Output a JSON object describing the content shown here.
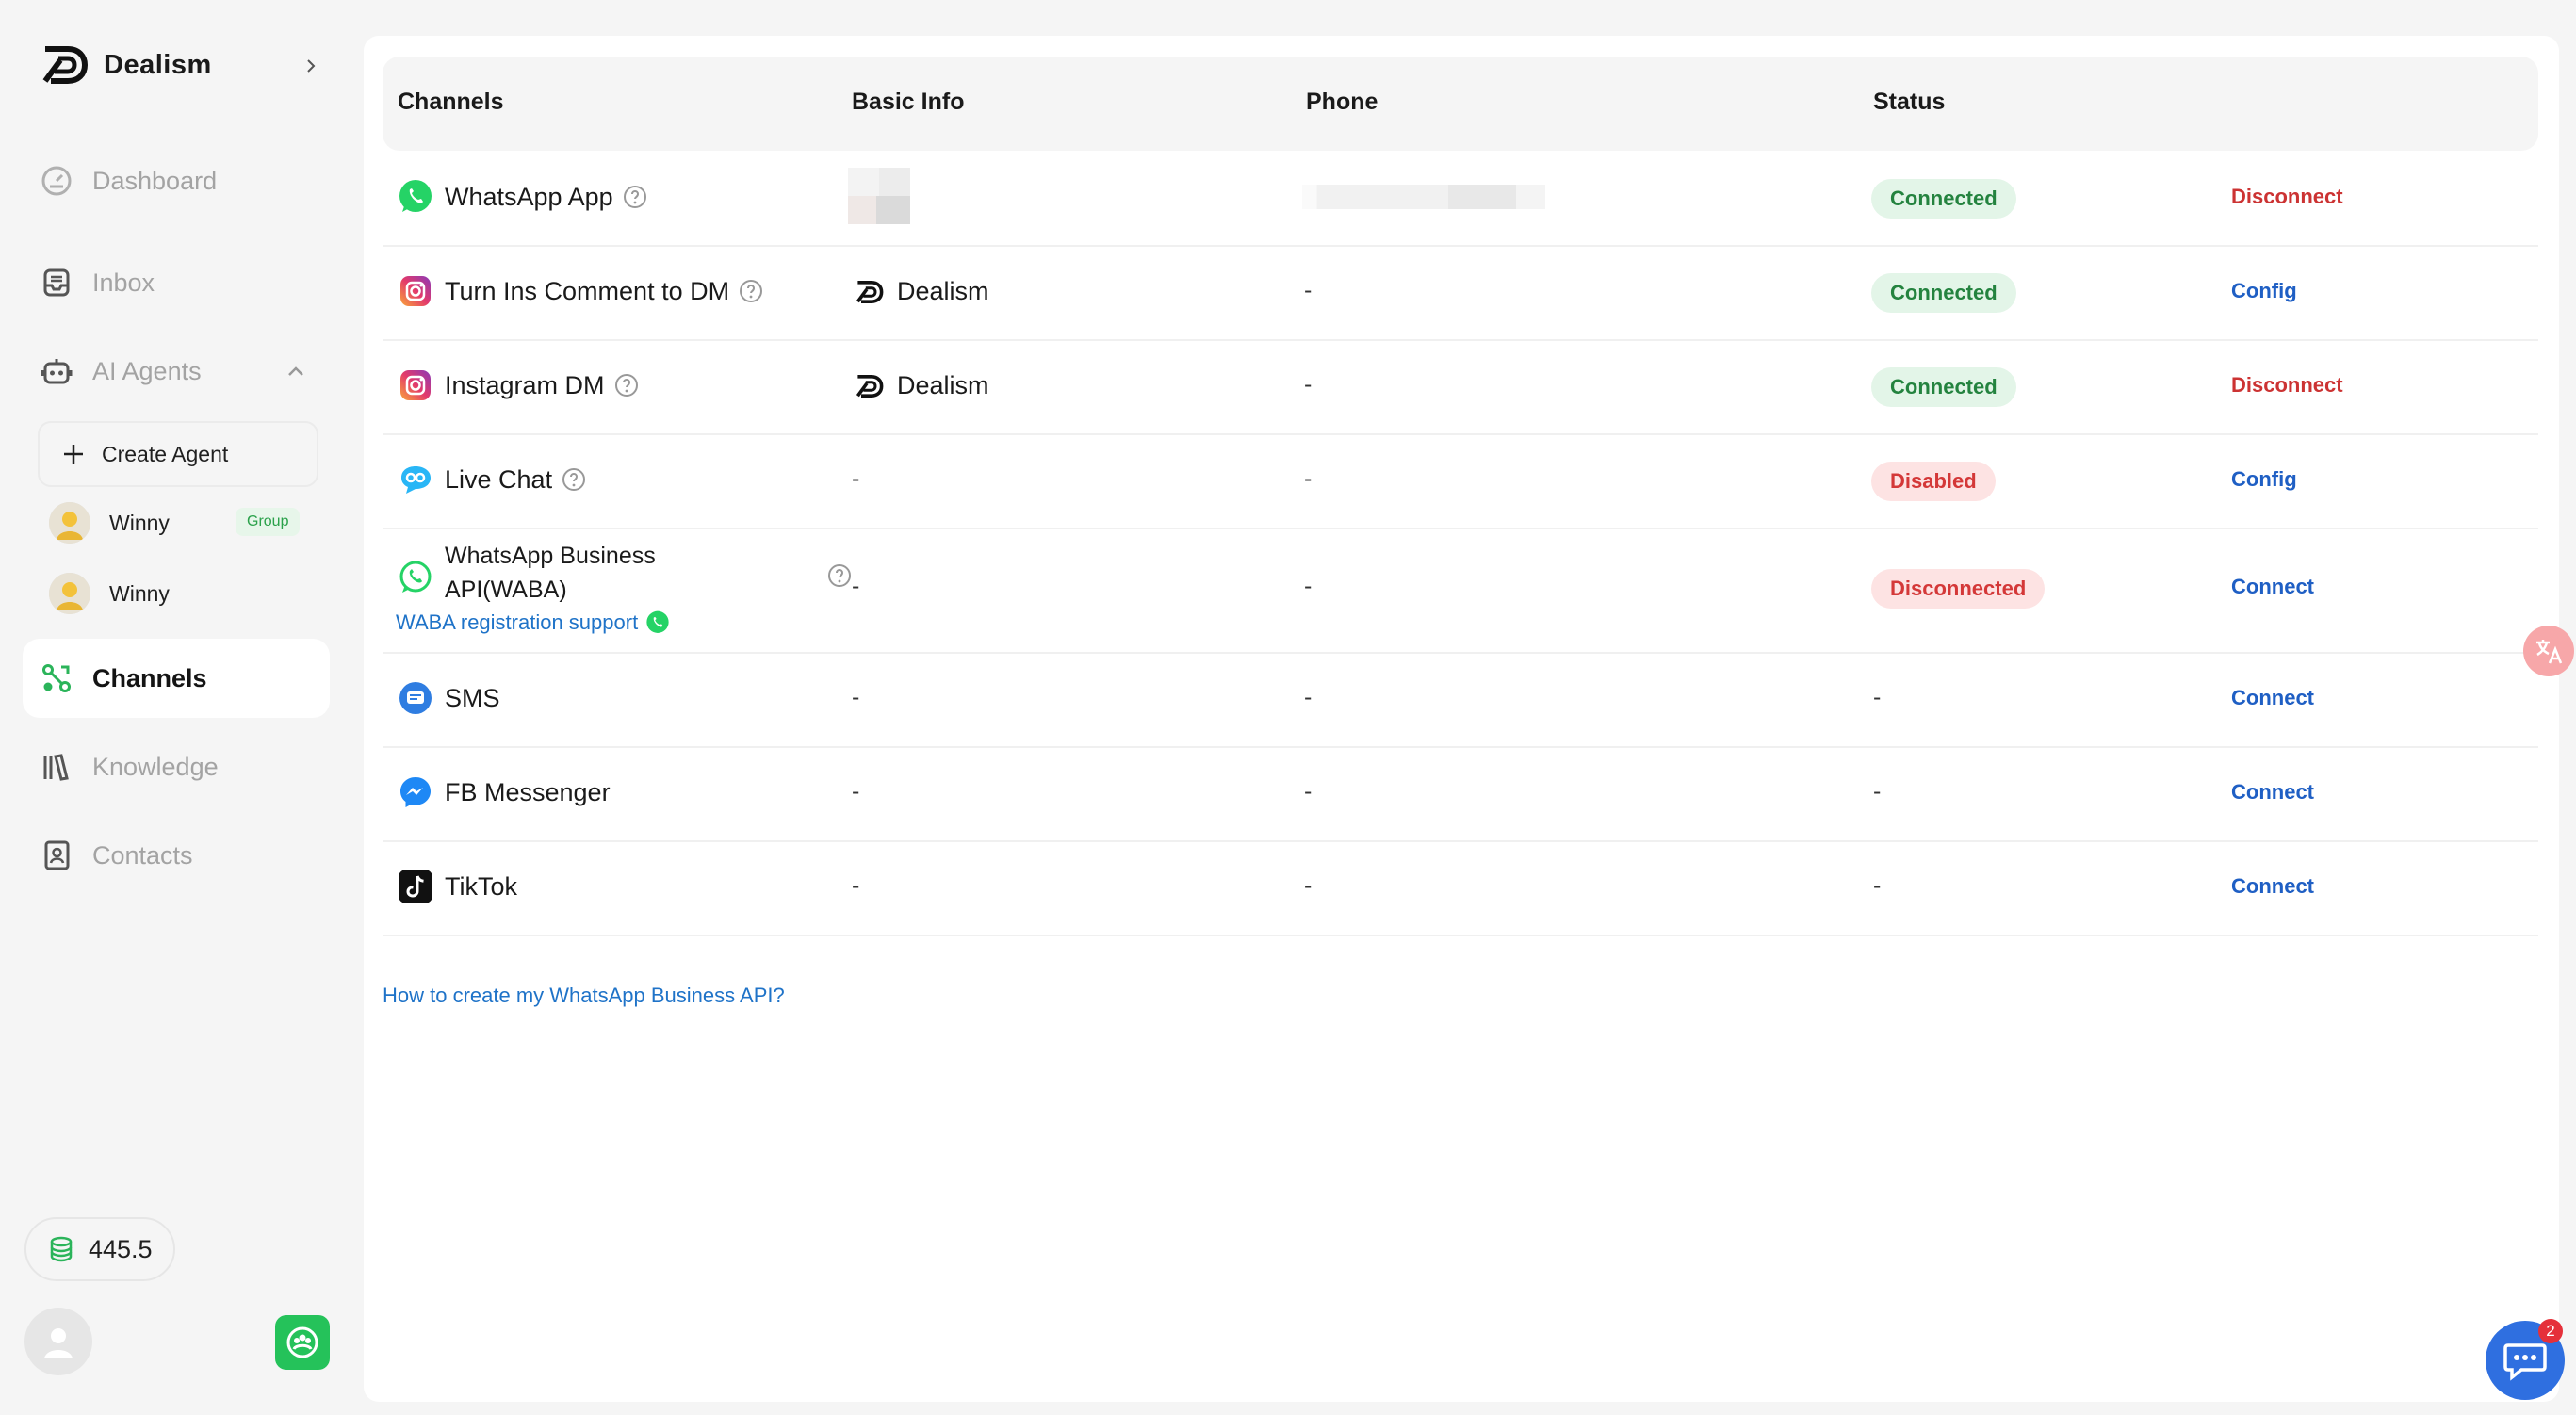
{
  "app": {
    "brand_name": "Dealism"
  },
  "sidebar": {
    "nav": {
      "dashboard": "Dashboard",
      "inbox": "Inbox",
      "ai_agents": "AI Agents",
      "channels": "Channels",
      "knowledge": "Knowledge",
      "contacts": "Contacts"
    },
    "create_agent": "Create Agent",
    "agents": [
      {
        "name": "Winny",
        "badge": "Group"
      },
      {
        "name": "Winny",
        "badge": ""
      }
    ],
    "credits": "445.5"
  },
  "table": {
    "headers": {
      "channels": "Channels",
      "basic_info": "Basic Info",
      "phone": "Phone",
      "status": "Status"
    },
    "rows": [
      {
        "channel": "WhatsApp App",
        "basic_info": "",
        "phone": "",
        "status": "Connected",
        "action": "Disconnect",
        "icon": "whatsapp-icon"
      },
      {
        "channel": "Turn Ins Comment to DM",
        "basic_info": "Dealism",
        "phone": "-",
        "status": "Connected",
        "action": "Config",
        "icon": "instagram-icon"
      },
      {
        "channel": "Instagram DM",
        "basic_info": "Dealism",
        "phone": "-",
        "status": "Connected",
        "action": "Disconnect",
        "icon": "instagram-icon"
      },
      {
        "channel": "Live Chat",
        "basic_info": "-",
        "phone": "-",
        "status": "Disabled",
        "action": "Config",
        "icon": "live-chat-icon"
      },
      {
        "channel": "WhatsApp Business API(WABA)",
        "basic_info": "-",
        "phone": "-",
        "status": "Disconnected",
        "action": "Connect",
        "icon": "whatsapp-business-icon",
        "support_link": "WABA registration support"
      },
      {
        "channel": "SMS",
        "basic_info": "-",
        "phone": "-",
        "status": "-",
        "action": "Connect",
        "icon": "sms-icon"
      },
      {
        "channel": "FB Messenger",
        "basic_info": "-",
        "phone": "-",
        "status": "-",
        "action": "Connect",
        "icon": "messenger-icon"
      },
      {
        "channel": "TikTok",
        "basic_info": "-",
        "phone": "-",
        "status": "-",
        "action": "Connect",
        "icon": "tiktok-icon"
      }
    ]
  },
  "help_link": "How to create my WhatsApp Business API?",
  "chat_widget": {
    "unread_count": "2"
  },
  "colors": {
    "connected": "#24833f",
    "disabled": "#d43838",
    "link": "#1f73c8",
    "accent_green": "#25c25a",
    "chat_blue": "#2f6fe0"
  }
}
